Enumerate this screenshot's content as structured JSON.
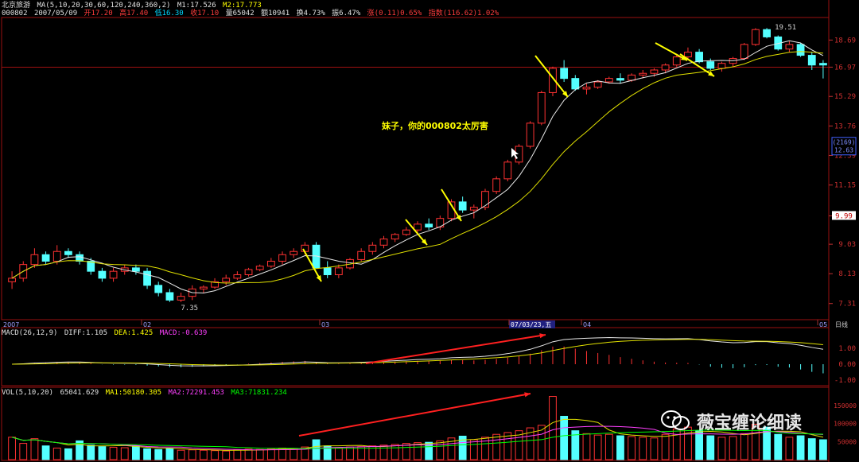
{
  "header": {
    "stock_name": "北京旅游",
    "ma_label": "MA(5,10,20,30,60,120,240,360,2)",
    "m1": "M1:17.526",
    "m2": "M2:17.773",
    "line2": {
      "code": "000802",
      "date": "2007/05/09",
      "open": "开17.20",
      "high": "高17.40",
      "low": "低16.30",
      "close": "收17.10",
      "volume": "量65042",
      "amount": "额10941",
      "turnover": "换4.73%",
      "amplitude": "振6.47%",
      "change": "涨(0.11)0.65%",
      "index": "指数(116.62)1.02%"
    }
  },
  "price_axis": {
    "ticks": [
      "18.69",
      "16.97",
      "15.29",
      "13.76",
      "12.39",
      "11.15",
      "9.99",
      "9.03",
      "8.13",
      "7.31"
    ],
    "current_tag": "16.97",
    "box_label_1": "(2169)",
    "box_label_2": "12.63",
    "marker_99": "9.99"
  },
  "x_axis": {
    "labels": [
      "2007",
      "02",
      "03",
      "07/03/23,五",
      "04",
      "05",
      "日线"
    ]
  },
  "annotations": {
    "text": "妹子，你的000802太厉害",
    "low_label": "7.35",
    "high_label": "19.51"
  },
  "macd": {
    "label": "MACD(26,12,9)",
    "diff": "DIFF:1.105",
    "dea": "DEA:1.425",
    "macd": "MACD:-0.639",
    "ticks": [
      "1.00",
      "0.00",
      "-1.00"
    ]
  },
  "vol": {
    "label": "VOL(5,10,20)",
    "value": "65041.629",
    "ma1": "MA1:50180.305",
    "ma2": "MA2:72291.453",
    "ma3": "MA3:71831.234",
    "ticks": [
      "150000",
      "100000",
      "50000"
    ]
  },
  "watermark": "薇宝缠论细读",
  "colors": {
    "up": "#ff3232",
    "down": "#54ffff",
    "ma_white": "#e8e8e8",
    "ma_yellow": "#e0e000",
    "arrow_yellow": "#ffff00",
    "arrow_red": "#ff2020",
    "grid_red": "#9a1010"
  },
  "chart_data": {
    "type": "candlestick",
    "ohlc": [
      [
        7.9,
        8.2,
        7.7,
        8.0
      ],
      [
        8.0,
        8.5,
        7.9,
        8.4
      ],
      [
        8.4,
        8.9,
        8.3,
        8.7
      ],
      [
        8.7,
        8.8,
        8.4,
        8.5
      ],
      [
        8.5,
        9.0,
        8.4,
        8.8
      ],
      [
        8.8,
        8.9,
        8.6,
        8.7
      ],
      [
        8.7,
        8.8,
        8.4,
        8.5
      ],
      [
        8.5,
        8.6,
        8.1,
        8.2
      ],
      [
        8.2,
        8.3,
        7.9,
        8.0
      ],
      [
        8.0,
        8.3,
        7.9,
        8.2
      ],
      [
        8.2,
        8.4,
        8.1,
        8.3
      ],
      [
        8.3,
        8.4,
        8.1,
        8.2
      ],
      [
        8.2,
        8.3,
        7.7,
        7.8
      ],
      [
        7.8,
        7.9,
        7.5,
        7.6
      ],
      [
        7.6,
        7.7,
        7.35,
        7.4
      ],
      [
        7.4,
        7.6,
        7.35,
        7.5
      ],
      [
        7.5,
        7.8,
        7.4,
        7.7
      ],
      [
        7.7,
        7.8,
        7.6,
        7.75
      ],
      [
        7.75,
        8.0,
        7.7,
        7.9
      ],
      [
        7.9,
        8.1,
        7.8,
        8.0
      ],
      [
        8.0,
        8.2,
        7.95,
        8.1
      ],
      [
        8.1,
        8.3,
        8.05,
        8.25
      ],
      [
        8.25,
        8.4,
        8.2,
        8.35
      ],
      [
        8.35,
        8.6,
        8.3,
        8.5
      ],
      [
        8.5,
        8.8,
        8.4,
        8.7
      ],
      [
        8.7,
        8.9,
        8.6,
        8.8
      ],
      [
        8.8,
        9.1,
        8.7,
        9.0
      ],
      [
        9.0,
        9.1,
        8.4,
        8.3
      ],
      [
        8.3,
        8.5,
        8.0,
        8.1
      ],
      [
        8.1,
        8.4,
        8.0,
        8.3
      ],
      [
        8.3,
        8.6,
        8.25,
        8.55
      ],
      [
        8.55,
        8.9,
        8.5,
        8.8
      ],
      [
        8.8,
        9.1,
        8.7,
        9.0
      ],
      [
        9.0,
        9.3,
        8.9,
        9.2
      ],
      [
        9.2,
        9.4,
        9.1,
        9.35
      ],
      [
        9.35,
        9.6,
        9.3,
        9.5
      ],
      [
        9.5,
        9.8,
        9.4,
        9.7
      ],
      [
        9.7,
        9.9,
        9.5,
        9.6
      ],
      [
        9.6,
        10.0,
        9.5,
        9.9
      ],
      [
        9.9,
        10.6,
        9.8,
        10.5
      ],
      [
        10.5,
        10.7,
        10.1,
        10.2
      ],
      [
        10.2,
        10.4,
        9.9,
        10.3
      ],
      [
        10.3,
        11.0,
        10.2,
        10.9
      ],
      [
        10.9,
        11.5,
        10.8,
        11.4
      ],
      [
        11.4,
        12.2,
        11.3,
        12.1
      ],
      [
        12.1,
        12.9,
        12.0,
        12.8
      ],
      [
        12.8,
        14.0,
        12.7,
        13.9
      ],
      [
        13.9,
        15.6,
        13.8,
        15.5
      ],
      [
        15.5,
        17.0,
        15.3,
        16.9
      ],
      [
        16.9,
        17.4,
        16.1,
        16.3
      ],
      [
        16.3,
        16.5,
        15.6,
        15.7
      ],
      [
        15.7,
        16.0,
        15.4,
        15.8
      ],
      [
        15.8,
        16.2,
        15.7,
        16.1
      ],
      [
        16.1,
        16.4,
        16.0,
        16.3
      ],
      [
        16.3,
        16.6,
        16.0,
        16.2
      ],
      [
        16.2,
        16.6,
        16.1,
        16.5
      ],
      [
        16.5,
        16.8,
        16.3,
        16.6
      ],
      [
        16.6,
        16.9,
        16.4,
        16.8
      ],
      [
        16.8,
        17.2,
        16.6,
        17.1
      ],
      [
        17.1,
        17.8,
        17.0,
        17.6
      ],
      [
        17.6,
        18.2,
        17.4,
        17.9
      ],
      [
        17.9,
        18.1,
        17.2,
        17.3
      ],
      [
        17.3,
        17.5,
        16.8,
        16.9
      ],
      [
        16.9,
        17.3,
        16.7,
        17.2
      ],
      [
        17.2,
        17.6,
        17.0,
        17.5
      ],
      [
        17.5,
        18.5,
        17.4,
        18.4
      ],
      [
        18.4,
        19.5,
        18.3,
        19.4
      ],
      [
        19.4,
        19.51,
        18.8,
        18.9
      ],
      [
        18.9,
        19.0,
        18.0,
        18.1
      ],
      [
        18.1,
        18.6,
        17.9,
        18.4
      ],
      [
        18.4,
        18.5,
        17.6,
        17.7
      ],
      [
        17.7,
        17.9,
        16.8,
        17.1
      ],
      [
        17.2,
        17.4,
        16.3,
        17.1
      ]
    ],
    "volume": [
      62000,
      45000,
      58000,
      38000,
      32000,
      30000,
      52000,
      40000,
      36000,
      34000,
      33000,
      38000,
      30000,
      28000,
      30000,
      26000,
      27000,
      26000,
      25000,
      24000,
      27000,
      29000,
      28000,
      30000,
      32000,
      31000,
      35000,
      55000,
      38000,
      33000,
      35000,
      36000,
      38000,
      40000,
      42000,
      45000,
      47000,
      48000,
      52000,
      60000,
      65000,
      55000,
      62000,
      70000,
      75000,
      80000,
      88000,
      95000,
      175000,
      120000,
      80000,
      72000,
      68000,
      70000,
      66000,
      64000,
      62000,
      60000,
      70000,
      85000,
      90000,
      80000,
      66000,
      62000,
      64000,
      72000,
      98000,
      90000,
      70000,
      62000,
      66000,
      58000,
      55000
    ],
    "macd_diff_range": [
      -1.2,
      1.8
    ],
    "note_dates": [
      "2007",
      "02",
      "03",
      "07/03/23",
      "04",
      "05"
    ]
  }
}
